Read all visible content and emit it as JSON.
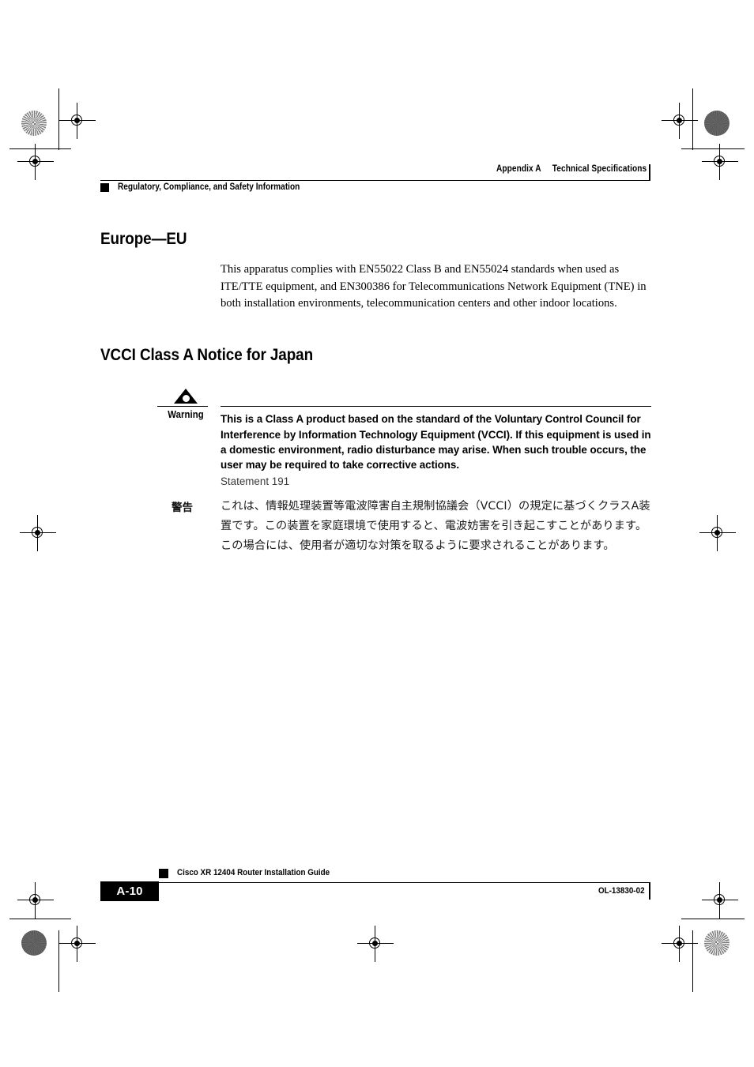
{
  "header": {
    "appendix": "Appendix A",
    "appendix_title": "Technical Specifications",
    "book_section": "Regulatory, Compliance, and Safety Information"
  },
  "sections": [
    {
      "heading": "Europe—EU",
      "paragraph": "This apparatus complies with EN55022 Class B and EN55024 standards when used as ITE/TTE equipment, and EN300386 for Telecommunications Network Equipment (TNE) in both installation environments, telecommunication centers and other indoor locations."
    },
    {
      "heading": "VCCI Class A Notice for Japan"
    }
  ],
  "warning": {
    "label": "Warning",
    "text": "This is a Class A product based on the standard of the Voluntary Control Council for Interference by Information Technology Equipment (VCCI). If this equipment is used in a domestic environment, radio disturbance may arise. When such trouble occurs, the user may be required to take corrective actions.",
    "statement": "Statement 191"
  },
  "warning_jp": {
    "label": "警告",
    "text": "これは、情報処理装置等電波障害自主規制協議会（VCCI）の規定に基づくクラスA装置です。この装置を家庭環境で使用すると、電波妨害を引き起こすことがあります。この場合には、使用者が適切な対策を取るように要求されることがあります。"
  },
  "footer": {
    "page_number": "A-10",
    "guide_title": "Cisco XR 12404 Router Installation Guide",
    "doc_id": "OL-13830-02"
  },
  "colors": {
    "ink": "#000000",
    "paper": "#ffffff",
    "statement_gray": "#3a3a3a"
  }
}
